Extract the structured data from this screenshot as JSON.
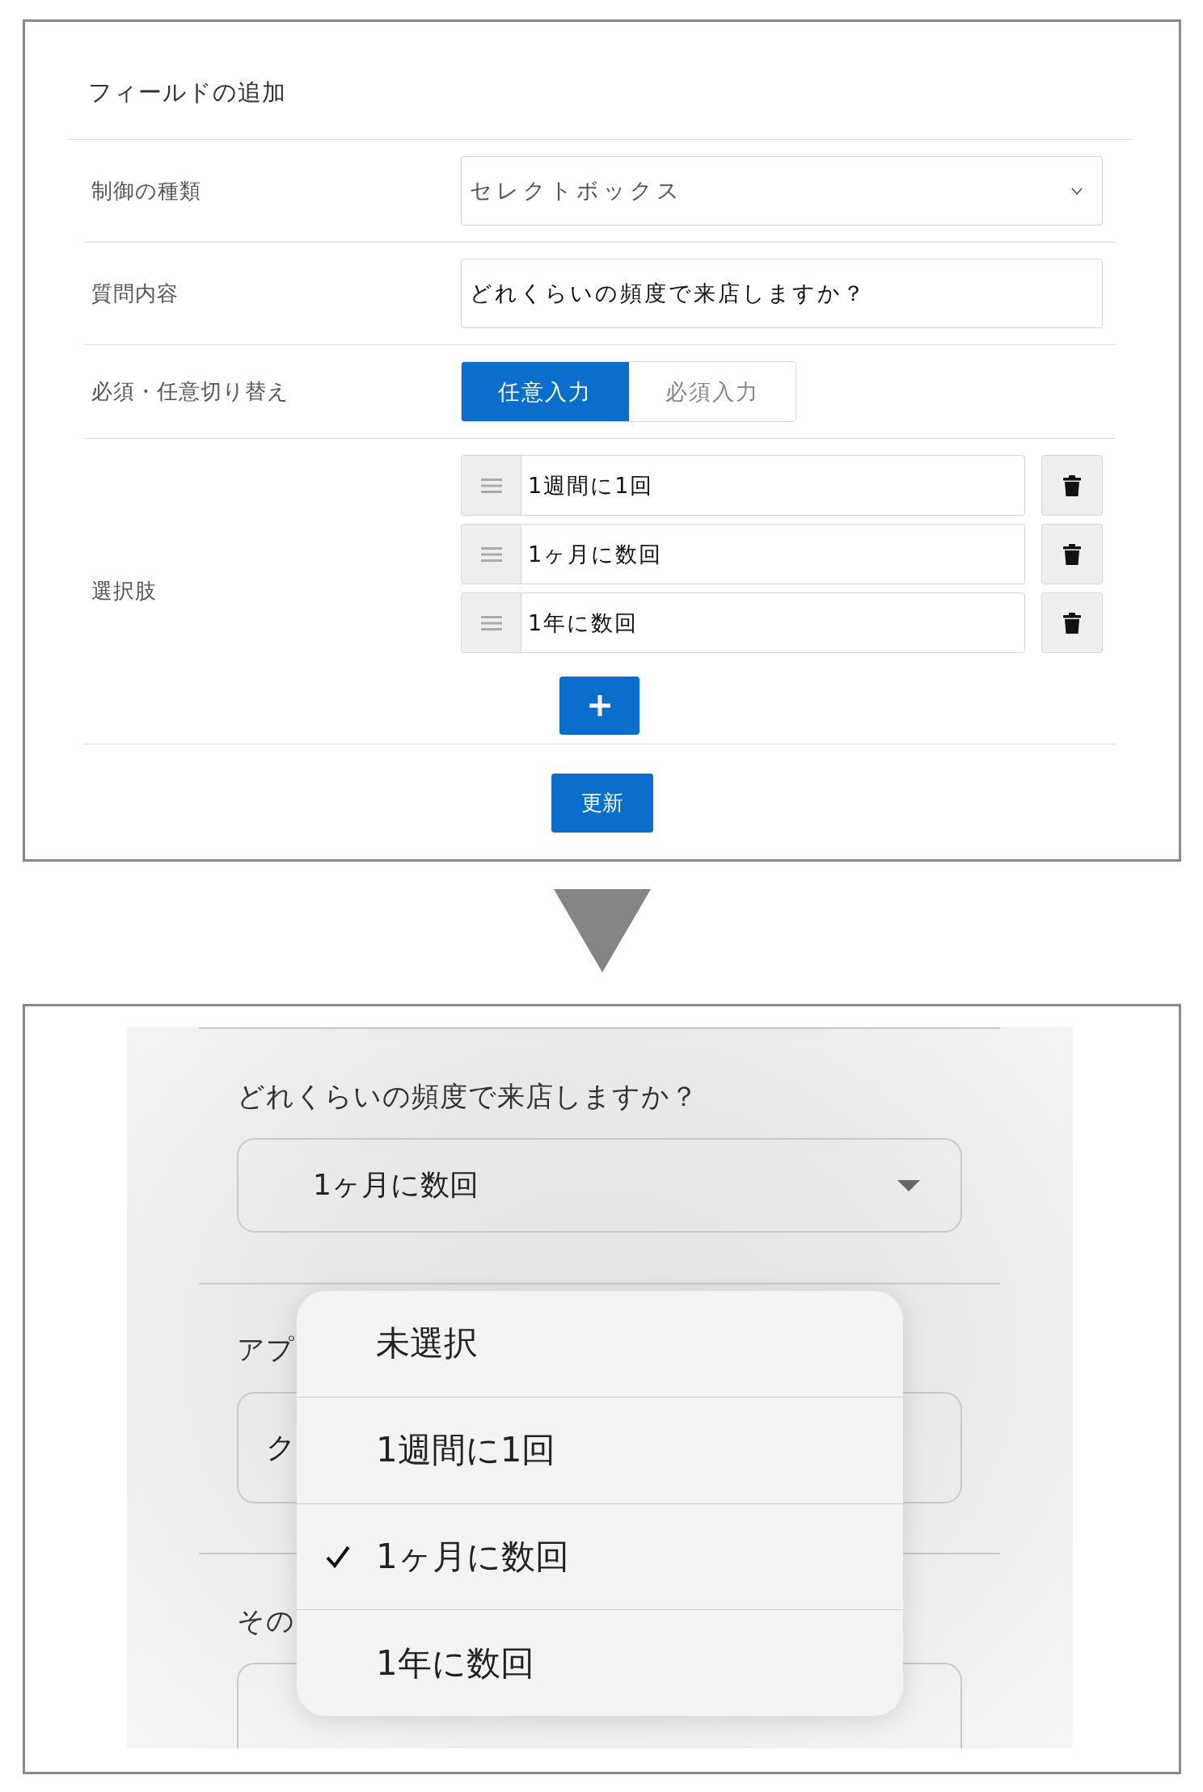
{
  "form": {
    "title": "フィールドの追加",
    "rows": [
      {
        "kind": "select",
        "label": "制御の種類",
        "value": "セレクトボックス"
      },
      {
        "kind": "text",
        "label": "質問内容",
        "value": "どれくらいの頻度で来店しますか？"
      },
      {
        "kind": "toggle",
        "label": "必須・任意切り替え",
        "options": [
          {
            "label": "任意入力",
            "selected": true
          },
          {
            "label": "必須入力",
            "selected": false
          }
        ]
      },
      {
        "kind": "choices",
        "label": "選択肢",
        "choices": [
          "1週間に1回",
          "1ヶ月に数回",
          "1年に数回"
        ]
      }
    ],
    "submit": "更新"
  },
  "preview": {
    "question": "どれくらいの頻度で来店しますか？",
    "select_value": "1ヶ月に数回",
    "field_2_label": "アプ",
    "field_2_value": "ク",
    "field_3_label": "その",
    "menu": [
      {
        "label": "未選択",
        "selected": false
      },
      {
        "label": "1週間に1回",
        "selected": false
      },
      {
        "label": "1ヶ月に数回",
        "selected": true
      },
      {
        "label": "1年に数回",
        "selected": false
      }
    ]
  }
}
